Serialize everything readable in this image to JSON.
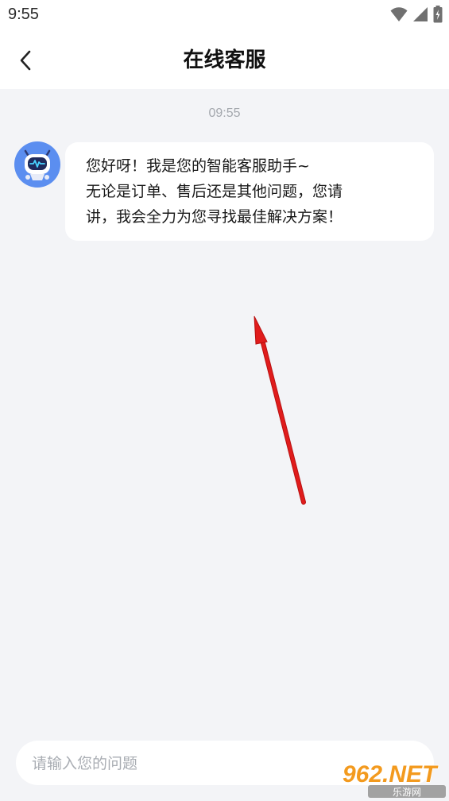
{
  "status_bar": {
    "time": "9:55",
    "icons": [
      "wifi-icon",
      "cell-signal-icon",
      "battery-icon"
    ]
  },
  "header": {
    "title": "在线客服",
    "back_icon": "chevron-left-icon"
  },
  "chat": {
    "timestamp": "09:55",
    "messages": [
      {
        "sender": "bot",
        "avatar_icon": "robot-avatar-icon",
        "lines": [
          "您好呀！我是您的智能客服助手~",
          "无论是订单、售后还是其他问题，您请",
          "讲，我会全力为您寻找最佳解决方案！"
        ]
      }
    ]
  },
  "input": {
    "placeholder": "请输入您的问题",
    "value": ""
  },
  "watermark": {
    "brand": "962.NET",
    "subtitle": "乐游网"
  },
  "colors": {
    "background": "#f3f4f7",
    "bubble": "#ffffff",
    "avatar_bg": "#5b8ef0",
    "annotation_arrow": "#e01c1c",
    "watermark_orange": "#f39a1e"
  }
}
